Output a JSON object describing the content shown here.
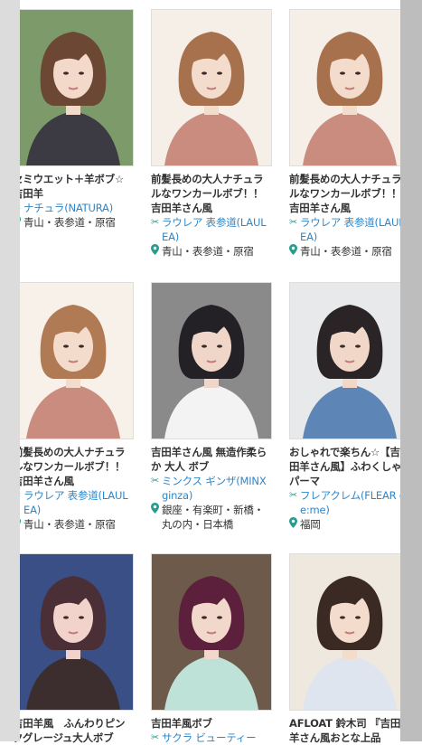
{
  "styles": [
    {
      "title": "セミウエット＋羊ボブ☆ 吉田羊",
      "salon": "ナチュラ(NATURA)",
      "area": "青山・表参道・原宿",
      "colors": {
        "bg": "#7d9a6a",
        "hair": "#6b4734",
        "skin": "#f3d9c9",
        "top": "#3c3a42"
      }
    },
    {
      "title": "前髪長めの大人ナチュラルなワンカールボブ！！吉田羊さん風",
      "salon": "ラウレア 表参道(LAULEA)",
      "area": "青山・表参道・原宿",
      "colors": {
        "bg": "#f5efe8",
        "hair": "#a8714e",
        "skin": "#f4dccd",
        "top": "#c98c7e"
      }
    },
    {
      "title": "前髪長めの大人ナチュラルなワンカールボブ！！吉田羊さん風",
      "salon": "ラウレア 表参道(LAULEA)",
      "area": "青山・表参道・原宿",
      "colors": {
        "bg": "#f5efe8",
        "hair": "#a8714e",
        "skin": "#f4dccd",
        "top": "#c98c7e"
      }
    },
    {
      "title": "前髪長めの大人ナチュラルなワンカールボブ！！吉田羊さん風",
      "salon": "ラウレア 表参道(LAULEA)",
      "area": "青山・表参道・原宿",
      "colors": {
        "bg": "#f7f1ea",
        "hair": "#b07a55",
        "skin": "#f4dccd",
        "top": "#c98c7e"
      }
    },
    {
      "title": "吉田羊さん風 無造作柔らか 大人 ボブ",
      "salon": "ミンクス ギンザ(MINX ginza)",
      "area": "銀座・有楽町・新橋・丸の内・日本橋",
      "colors": {
        "bg": "#8a8a8a",
        "hair": "#232126",
        "skin": "#f0d6c8",
        "top": "#f3f3f3"
      }
    },
    {
      "title": "おしゃれで楽ちん☆【吉田羊さん風】ふわくしゃパーマ",
      "salon": "フレアクレム(FLEAR cre:me)",
      "area": "福岡",
      "colors": {
        "bg": "#e7e9ea",
        "hair": "#2a2427",
        "skin": "#f1d7c8",
        "top": "#5d86b7"
      }
    },
    {
      "title": "吉田羊風　ふんわりピンクグレージュ大人ボブ",
      "salon": "",
      "area": "",
      "colors": {
        "bg": "#3a4f86",
        "hair": "#4a2f36",
        "skin": "#f2d3cb",
        "top": "#3c2e2f"
      }
    },
    {
      "title": "吉田羊風ボブ",
      "salon": "サクラ ビューティー",
      "area": "",
      "colors": {
        "bg": "#6e5a4a",
        "hair": "#5c1f3c",
        "skin": "#f2d8ca",
        "top": "#bfe2d8"
      }
    },
    {
      "title": "AFLOAT 鈴木司 『吉田羊さん風おとな上品",
      "salon": "",
      "area": "",
      "colors": {
        "bg": "#eee8df",
        "hair": "#3b2a24",
        "skin": "#f4dccd",
        "top": "#dfe5ee"
      }
    }
  ]
}
